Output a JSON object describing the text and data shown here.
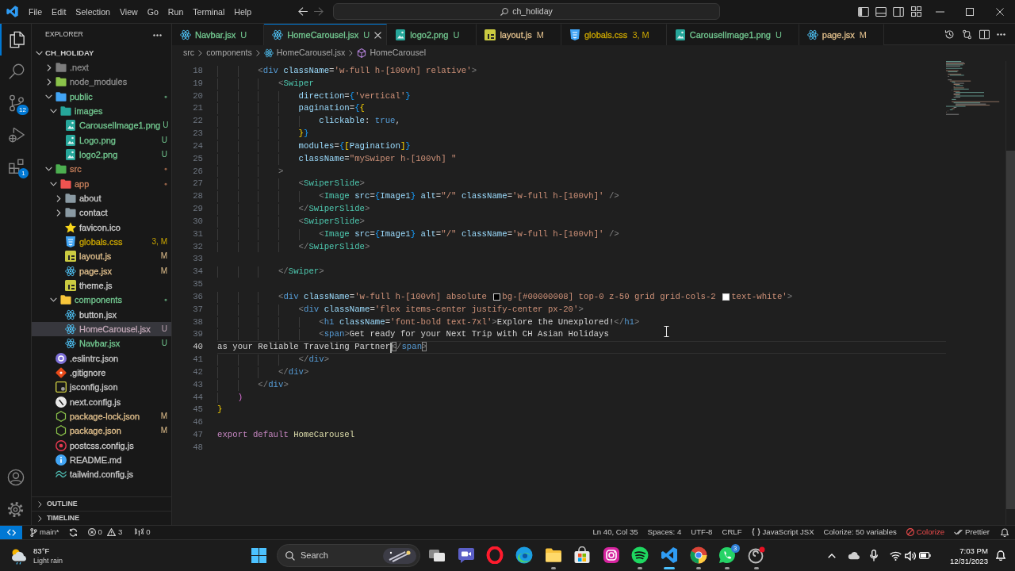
{
  "title_bar": {
    "menu": [
      "File",
      "Edit",
      "Selection",
      "View",
      "Go",
      "Run",
      "Terminal",
      "Help"
    ],
    "navigation": [
      {
        "kind": "back",
        "disabled": false
      },
      {
        "kind": "forward",
        "disabled": true
      }
    ],
    "command_center": {
      "label": "ch_holiday"
    }
  },
  "activity_bar": {
    "items": [
      {
        "kind": "explorer",
        "selected": true
      },
      {
        "kind": "search",
        "selected": false
      },
      {
        "kind": "source-control",
        "selected": false,
        "badge": "12"
      },
      {
        "kind": "run",
        "selected": false
      },
      {
        "kind": "extensions",
        "selected": false,
        "badge": "1"
      }
    ]
  },
  "sidebar": {
    "title": "EXPLORER",
    "root": {
      "label": "CH_HOLIDAY",
      "expanded": true
    },
    "tree": [
      {
        "label": ".next",
        "kind": "nextfolder",
        "color": "#8c8c8c",
        "expanded": false,
        "selected": false
      },
      {
        "label": "node_modules",
        "kind": "libfolder",
        "color": "#8c8c8c",
        "expanded": false,
        "selected": false
      },
      {
        "label": "public",
        "kind": "publicfolder",
        "color": "#73c991",
        "status": "●",
        "expanded": true,
        "selected": false,
        "children": [
          {
            "label": "images",
            "kind": "imagefolder",
            "color": "#73c991",
            "expanded": true,
            "selected": false,
            "children": [
              {
                "label": "CarouselImage1.png",
                "kind": "image",
                "color": "#73c991",
                "status": "U",
                "selected": false
              },
              {
                "label": "Logo.png",
                "kind": "image",
                "color": "#73c991",
                "status": "U",
                "selected": false
              },
              {
                "label": "logo2.png",
                "kind": "image",
                "color": "#73c991",
                "status": "U",
                "selected": false
              }
            ]
          }
        ]
      },
      {
        "label": "src",
        "kind": "srcfolder",
        "color": "#c9805c",
        "status": "●",
        "expanded": true,
        "selected": false,
        "children": [
          {
            "label": "app",
            "kind": "appfolder",
            "color": "#c9805c",
            "status": "●",
            "expanded": true,
            "selected": false,
            "children": [
              {
                "label": "about",
                "kind": "folder",
                "color": "#cccccc",
                "expanded": false,
                "selected": false
              },
              {
                "label": "contact",
                "kind": "folder",
                "color": "#cccccc",
                "expanded": false,
                "selected": false
              },
              {
                "label": "favicon.ico",
                "kind": "star",
                "color": "#cccccc",
                "selected": false
              },
              {
                "label": "globals.css",
                "kind": "css",
                "color": "#cca700",
                "status": "3, M",
                "selected": false
              },
              {
                "label": "layout.js",
                "kind": "js",
                "color": "#e2c08d",
                "status": "M",
                "selected": false
              },
              {
                "label": "page.jsx",
                "kind": "react",
                "color": "#e2c08d",
                "status": "M",
                "selected": false
              },
              {
                "label": "theme.js",
                "kind": "js",
                "color": "#cccccc",
                "selected": false
              }
            ]
          },
          {
            "label": "components",
            "kind": "componentfolder",
            "color": "#73c991",
            "status": "●",
            "expanded": true,
            "selected": false,
            "children": [
              {
                "label": "button.jsx",
                "kind": "react",
                "color": "#cccccc",
                "selected": false
              },
              {
                "label": "HomeCarousel.jsx",
                "kind": "react",
                "color": "#bfa5b4",
                "status": "U",
                "selected": true
              },
              {
                "label": "Navbar.jsx",
                "kind": "react",
                "color": "#73c991",
                "status": "U",
                "selected": false
              }
            ]
          }
        ]
      },
      {
        "label": ".eslintrc.json",
        "kind": "eslint",
        "color": "#cccccc",
        "selected": false
      },
      {
        "label": ".gitignore",
        "kind": "git",
        "color": "#cccccc",
        "selected": false
      },
      {
        "label": "jsconfig.json",
        "kind": "jsconfig",
        "color": "#cccccc",
        "selected": false
      },
      {
        "label": "next.config.js",
        "kind": "next",
        "color": "#cccccc",
        "selected": false
      },
      {
        "label": "package-lock.json",
        "kind": "node",
        "color": "#e2c08d",
        "status": "M",
        "selected": false
      },
      {
        "label": "package.json",
        "kind": "node",
        "color": "#e2c08d",
        "status": "M",
        "selected": false
      },
      {
        "label": "postcss.config.js",
        "kind": "postcss",
        "color": "#cccccc",
        "selected": false
      },
      {
        "label": "README.md",
        "kind": "info",
        "color": "#cccccc",
        "selected": false
      },
      {
        "label": "tailwind.config.js",
        "kind": "tailwind",
        "color": "#cccccc",
        "selected": false
      }
    ],
    "sections": [
      {
        "label": "OUTLINE",
        "expanded": false
      },
      {
        "label": "TIMELINE",
        "expanded": false
      }
    ]
  },
  "tabs": [
    {
      "label": "Navbar.jsx",
      "status": "U",
      "kind": "react",
      "color": "#73c991",
      "selected": false
    },
    {
      "label": "HomeCarousel.jsx",
      "status": "U",
      "kind": "react",
      "color": "#73c991",
      "selected": true
    },
    {
      "label": "logo2.png",
      "status": "U",
      "kind": "image",
      "color": "#73c991",
      "selected": false
    },
    {
      "label": "layout.js",
      "status": "M",
      "kind": "js",
      "color": "#e2c08d",
      "selected": false
    },
    {
      "label": "globals.css",
      "status": "3, M",
      "kind": "css",
      "color": "#cca700",
      "selected": false
    },
    {
      "label": "CarouselImage1.png",
      "status": "U",
      "kind": "image",
      "color": "#73c991",
      "selected": false
    },
    {
      "label": "page.jsx",
      "status": "M",
      "kind": "react",
      "color": "#e2c08d",
      "selected": false
    }
  ],
  "breadcrumbs": [
    {
      "label": "src",
      "kind": "folder"
    },
    {
      "label": "components",
      "kind": "folder"
    },
    {
      "label": "HomeCarousel.jsx",
      "kind": "react"
    },
    {
      "label": "HomeCarousel",
      "kind": "symbol"
    }
  ],
  "editor": {
    "lines": [
      {
        "number": "18",
        "current": false,
        "tokens": [
          {
            "text": "        <",
            "kind": "punct"
          },
          {
            "text": "div",
            "kind": "tag"
          },
          {
            "text": " className",
            "kind": "attr"
          },
          {
            "text": "=",
            "kind": "operator"
          },
          {
            "text": "'w-full h-[100vh] relative'",
            "kind": "string"
          },
          {
            "text": ">",
            "kind": "punct"
          }
        ]
      },
      {
        "number": "19",
        "current": false,
        "tokens": [
          {
            "text": "            <",
            "kind": "punct"
          },
          {
            "text": "Swiper",
            "kind": "component"
          }
        ]
      },
      {
        "number": "20",
        "current": false,
        "tokens": [
          {
            "text": "                direction",
            "kind": "attr"
          },
          {
            "text": "=",
            "kind": "operator"
          },
          {
            "text": "{",
            "kind": "bracket3"
          },
          {
            "text": "'vertical'",
            "kind": "string"
          },
          {
            "text": "}",
            "kind": "bracket3"
          }
        ]
      },
      {
        "number": "21",
        "current": false,
        "tokens": [
          {
            "text": "                pagination",
            "kind": "attr"
          },
          {
            "text": "=",
            "kind": "operator"
          },
          {
            "text": "{",
            "kind": "bracket3"
          },
          {
            "text": "{",
            "kind": "bracket1"
          }
        ]
      },
      {
        "number": "22",
        "current": false,
        "tokens": [
          {
            "text": "                    clickable",
            "kind": "attr"
          },
          {
            "text": ":",
            "kind": "operator"
          },
          {
            "text": " true",
            "kind": "keyword"
          },
          {
            "text": ",",
            "kind": "operator"
          }
        ]
      },
      {
        "number": "23",
        "current": false,
        "tokens": [
          {
            "text": "                }",
            "kind": "bracket1"
          },
          {
            "text": "}",
            "kind": "bracket3"
          }
        ]
      },
      {
        "number": "24",
        "current": false,
        "tokens": [
          {
            "text": "                modules",
            "kind": "attr"
          },
          {
            "text": "=",
            "kind": "operator"
          },
          {
            "text": "{",
            "kind": "bracket3"
          },
          {
            "text": "[",
            "kind": "bracket1"
          },
          {
            "text": "Pagination",
            "kind": "variable"
          },
          {
            "text": "]",
            "kind": "bracket1"
          },
          {
            "text": "}",
            "kind": "bracket3"
          }
        ]
      },
      {
        "number": "25",
        "current": false,
        "tokens": [
          {
            "text": "                className",
            "kind": "attr"
          },
          {
            "text": "=",
            "kind": "operator"
          },
          {
            "text": "\"mySwiper h-[100vh] \"",
            "kind": "string"
          }
        ]
      },
      {
        "number": "26",
        "current": false,
        "tokens": [
          {
            "text": "            >",
            "kind": "punct"
          }
        ]
      },
      {
        "number": "27",
        "current": false,
        "tokens": [
          {
            "text": "                <",
            "kind": "punct"
          },
          {
            "text": "SwiperSlide",
            "kind": "component"
          },
          {
            "text": ">",
            "kind": "punct"
          }
        ]
      },
      {
        "number": "28",
        "current": false,
        "tokens": [
          {
            "text": "                    <",
            "kind": "punct"
          },
          {
            "text": "Image",
            "kind": "component"
          },
          {
            "text": " src",
            "kind": "attr"
          },
          {
            "text": "=",
            "kind": "operator"
          },
          {
            "text": "{",
            "kind": "bracket3"
          },
          {
            "text": "Image1",
            "kind": "variable"
          },
          {
            "text": "}",
            "kind": "bracket3"
          },
          {
            "text": " alt",
            "kind": "attr"
          },
          {
            "text": "=",
            "kind": "operator"
          },
          {
            "text": "\"/\"",
            "kind": "string"
          },
          {
            "text": " className",
            "kind": "attr"
          },
          {
            "text": "=",
            "kind": "operator"
          },
          {
            "text": "'w-full h-[100vh]'",
            "kind": "string"
          },
          {
            "text": " />",
            "kind": "punct"
          }
        ]
      },
      {
        "number": "29",
        "current": false,
        "tokens": [
          {
            "text": "                </",
            "kind": "punct"
          },
          {
            "text": "SwiperSlide",
            "kind": "component"
          },
          {
            "text": ">",
            "kind": "punct"
          }
        ]
      },
      {
        "number": "30",
        "current": false,
        "tokens": [
          {
            "text": "                <",
            "kind": "punct"
          },
          {
            "text": "SwiperSlide",
            "kind": "component"
          },
          {
            "text": ">",
            "kind": "punct"
          }
        ]
      },
      {
        "number": "31",
        "current": false,
        "tokens": [
          {
            "text": "                    <",
            "kind": "punct"
          },
          {
            "text": "Image",
            "kind": "component"
          },
          {
            "text": " src",
            "kind": "attr"
          },
          {
            "text": "=",
            "kind": "operator"
          },
          {
            "text": "{",
            "kind": "bracket3"
          },
          {
            "text": "Image1",
            "kind": "variable"
          },
          {
            "text": "}",
            "kind": "bracket3"
          },
          {
            "text": " alt",
            "kind": "attr"
          },
          {
            "text": "=",
            "kind": "operator"
          },
          {
            "text": "\"/\"",
            "kind": "string"
          },
          {
            "text": " className",
            "kind": "attr"
          },
          {
            "text": "=",
            "kind": "operator"
          },
          {
            "text": "'w-full h-[100vh]'",
            "kind": "string"
          },
          {
            "text": " />",
            "kind": "punct"
          }
        ]
      },
      {
        "number": "32",
        "current": false,
        "tokens": [
          {
            "text": "                </",
            "kind": "punct"
          },
          {
            "text": "SwiperSlide",
            "kind": "component"
          },
          {
            "text": ">",
            "kind": "punct"
          }
        ]
      },
      {
        "number": "33",
        "current": false
      },
      {
        "number": "34",
        "current": false,
        "tokens": [
          {
            "text": "            </",
            "kind": "punct"
          },
          {
            "text": "Swiper",
            "kind": "component"
          },
          {
            "text": ">",
            "kind": "punct"
          }
        ]
      },
      {
        "number": "35",
        "current": false
      },
      {
        "number": "36",
        "current": false,
        "tokens": [
          {
            "text": "            <",
            "kind": "punct"
          },
          {
            "text": "div",
            "kind": "tag"
          },
          {
            "text": " className",
            "kind": "attr"
          },
          {
            "text": "=",
            "kind": "operator"
          },
          {
            "text": "'w-full h-[100vh] absolute ",
            "kind": "string"
          },
          {
            "kind": "swatch",
            "color": "#000000"
          },
          {
            "text": "bg-[#00000008] top-0 z-50 grid grid-cols-2 ",
            "kind": "string"
          },
          {
            "kind": "swatch",
            "color": "#ffffff"
          },
          {
            "text": "text-white'",
            "kind": "string"
          },
          {
            "text": ">",
            "kind": "punct"
          }
        ]
      },
      {
        "number": "37",
        "current": false,
        "tokens": [
          {
            "text": "                <",
            "kind": "punct"
          },
          {
            "text": "div",
            "kind": "tag"
          },
          {
            "text": " className",
            "kind": "attr"
          },
          {
            "text": "=",
            "kind": "operator"
          },
          {
            "text": "'flex items-center justify-center px-20'",
            "kind": "string"
          },
          {
            "text": ">",
            "kind": "punct"
          }
        ]
      },
      {
        "number": "38",
        "current": false,
        "tokens": [
          {
            "text": "                    <",
            "kind": "punct"
          },
          {
            "text": "h1",
            "kind": "tag"
          },
          {
            "text": " className",
            "kind": "attr"
          },
          {
            "text": "=",
            "kind": "operator"
          },
          {
            "text": "'font-bold text-7xl'",
            "kind": "string"
          },
          {
            "text": ">",
            "kind": "punct"
          },
          {
            "text": "Explore the Unexplored!",
            "kind": "text"
          },
          {
            "text": "</",
            "kind": "punct"
          },
          {
            "text": "h1",
            "kind": "tag"
          },
          {
            "text": ">",
            "kind": "punct"
          }
        ]
      },
      {
        "number": "39",
        "current": false,
        "tokens": [
          {
            "text": "                    <",
            "kind": "punct"
          },
          {
            "text": "span",
            "kind": "tag"
          },
          {
            "text": ">",
            "kind": "punct"
          },
          {
            "text": "Get ready for your Next Trip with CH Asian Holidays",
            "kind": "text"
          }
        ]
      },
      {
        "number": "40",
        "current": true,
        "tokens": [
          {
            "text": "as your Reliable Traveling Partner",
            "kind": "text"
          },
          {
            "kind": "caret"
          },
          {
            "text": "<",
            "kind": "bracketmatch"
          },
          {
            "text": "/",
            "kind": "punct"
          },
          {
            "text": "span",
            "kind": "tag"
          },
          {
            "text": ">",
            "kind": "bracketmatch"
          }
        ]
      },
      {
        "number": "41",
        "current": false,
        "tokens": [
          {
            "text": "                </",
            "kind": "punct"
          },
          {
            "text": "div",
            "kind": "tag"
          },
          {
            "text": ">",
            "kind": "punct"
          }
        ]
      },
      {
        "number": "42",
        "current": false,
        "tokens": [
          {
            "text": "            </",
            "kind": "punct"
          },
          {
            "text": "div",
            "kind": "tag"
          },
          {
            "text": ">",
            "kind": "punct"
          }
        ]
      },
      {
        "number": "43",
        "current": false,
        "tokens": [
          {
            "text": "        </",
            "kind": "punct"
          },
          {
            "text": "div",
            "kind": "tag"
          },
          {
            "text": ">",
            "kind": "punct"
          }
        ]
      },
      {
        "number": "44",
        "current": false,
        "tokens": [
          {
            "text": "    )",
            "kind": "bracket2"
          }
        ]
      },
      {
        "number": "45",
        "current": false,
        "tokens": [
          {
            "text": "}",
            "kind": "bracket1"
          }
        ]
      },
      {
        "number": "46",
        "current": false
      },
      {
        "number": "47",
        "current": false,
        "tokens": [
          {
            "text": "export",
            "kind": "control"
          },
          {
            "text": " default",
            "kind": "control"
          },
          {
            "text": " HomeCarousel",
            "kind": "function"
          }
        ]
      },
      {
        "number": "48",
        "current": false
      }
    ]
  },
  "status_bar": {
    "branch": "main*",
    "errors": "0",
    "warnings": "3",
    "ports": "0",
    "items": [
      {
        "kind": "plain",
        "label": "Ln 40, Col 35"
      },
      {
        "kind": "plain",
        "label": "Spaces: 4"
      },
      {
        "kind": "plain",
        "label": "UTF-8"
      },
      {
        "kind": "plain",
        "label": "CRLF"
      },
      {
        "kind": "language",
        "label": "JavaScript JSX"
      },
      {
        "kind": "plain",
        "label": "Colorize: 50 variables"
      },
      {
        "kind": "disabled",
        "label": "Colorize"
      },
      {
        "kind": "check",
        "label": "Prettier"
      }
    ]
  },
  "taskbar": {
    "weather": {
      "temperature": "83°F",
      "condition": "Light rain"
    },
    "search": {
      "placeholder": "Search"
    },
    "apps": [
      {
        "kind": "taskview",
        "selected": false,
        "running": false
      },
      {
        "kind": "meet",
        "selected": false,
        "running": false
      },
      {
        "kind": "opera",
        "selected": false,
        "running": false
      },
      {
        "kind": "edge",
        "selected": false,
        "running": false
      },
      {
        "kind": "files",
        "selected": false,
        "running": true
      },
      {
        "kind": "store",
        "selected": false,
        "running": false
      },
      {
        "kind": "instagram",
        "selected": false,
        "running": false
      },
      {
        "kind": "spotify",
        "selected": false,
        "running": true
      },
      {
        "kind": "vscode",
        "selected": true,
        "running": true
      },
      {
        "kind": "chrome",
        "selected": false,
        "running": true
      },
      {
        "kind": "whatsapp",
        "selected": false,
        "running": true,
        "badge": "3"
      },
      {
        "kind": "photos",
        "selected": false,
        "running": true
      }
    ],
    "clock": {
      "time": "7:03 PM",
      "date": "12/31/2023"
    }
  }
}
